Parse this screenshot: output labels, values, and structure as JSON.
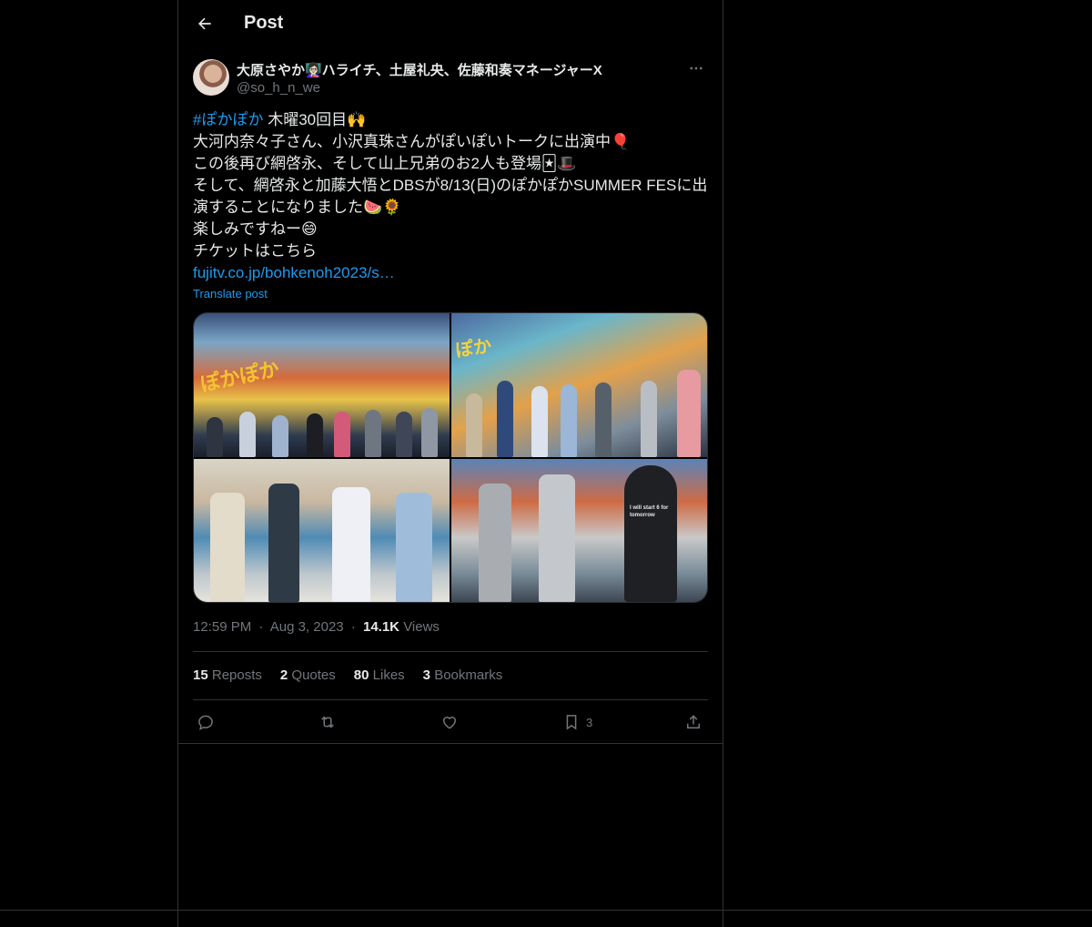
{
  "header": {
    "title": "Post",
    "back_icon": "arrow-left-icon"
  },
  "author": {
    "display_name": "大原さやか👩🏻‍🏫ハライチ、土屋礼央、佐藤和奏マネージャーX",
    "handle": "@so_h_n_we",
    "more_icon": "more-horizontal-icon"
  },
  "tweet": {
    "hashtag": "#ぽかぽか",
    "line1_rest": " 木曜30回目🙌",
    "line2": "大河内奈々子さん、小沢真珠さんがぽいぽいトークに出演中🎈",
    "line3": "この後再び網啓永、そして山上兄弟のお2人も登場🃏🎩",
    "line4": "そして、網啓永と加藤大悟とDBSが8/13(日)のぽかぽかSUMMER FESに出",
    "line5": "演することになりました🍉🌻",
    "line6": "楽しみですねー😄",
    "line7": "チケットはこちら",
    "link": "fujitv.co.jp/bohkenoh2023/s…",
    "translate": "Translate post"
  },
  "media": {
    "photo1_text": "ぽかぽか",
    "photo2_text": "ぽか",
    "photo4_text": "I will start 6 for tomorrow"
  },
  "meta": {
    "time": "12:59 PM",
    "sep": "·",
    "date": "Aug 3, 2023",
    "views_count": "14.1K",
    "views_label": "Views"
  },
  "stats": {
    "reposts_count": "15",
    "reposts_label": "Reposts",
    "quotes_count": "2",
    "quotes_label": "Quotes",
    "likes_count": "80",
    "likes_label": "Likes",
    "bookmarks_count": "3",
    "bookmarks_label": "Bookmarks"
  },
  "actions": {
    "bookmark_count": "3"
  }
}
